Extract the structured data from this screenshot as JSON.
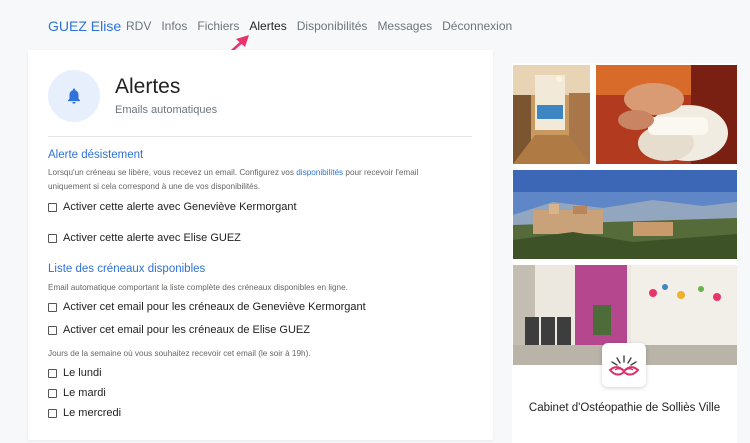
{
  "nav": {
    "brand": "GUEZ Elise",
    "links": [
      "RDV",
      "Infos",
      "Fichiers",
      "Alertes",
      "Disponibilités",
      "Messages",
      "Déconnexion"
    ],
    "active": "Alertes"
  },
  "header": {
    "title": "Alertes",
    "subtitle": "Emails automatiques",
    "icon": "bell-icon"
  },
  "desistement": {
    "title": "Alerte désistement",
    "desc_part1": "Lorsqu'un créneau se libère, vous recevez un email. Configurez vos ",
    "desc_link": "disponibilités",
    "desc_part2": " pour recevoir l'email",
    "desc_line2": "uniquement si cela correspond à une de vos disponibilités.",
    "options": [
      "Activer cette alerte avec Geneviève Kermorgant",
      "Activer cette alerte avec Elise GUEZ"
    ]
  },
  "liste": {
    "title": "Liste des créneaux disponibles",
    "desc": "Email automatique comportant la liste complète des créneaux disponibles en ligne.",
    "options": [
      "Activer cet email pour les créneaux de Geneviève Kermorgant",
      "Activer cet email pour les créneaux de Elise GUEZ"
    ],
    "days_label": "Jours de la semaine où vous souhaitez recevoir cet email (le soir à 19h).",
    "days": [
      "Le lundi",
      "Le mardi",
      "Le mercredi"
    ]
  },
  "sidebar": {
    "cabinet_name": "Cabinet d'Ostéopathie de Solliès Ville",
    "logo_icon": "lotus-logo"
  },
  "colors": {
    "accent": "#2f72d8",
    "arrow": "#e8336b"
  }
}
